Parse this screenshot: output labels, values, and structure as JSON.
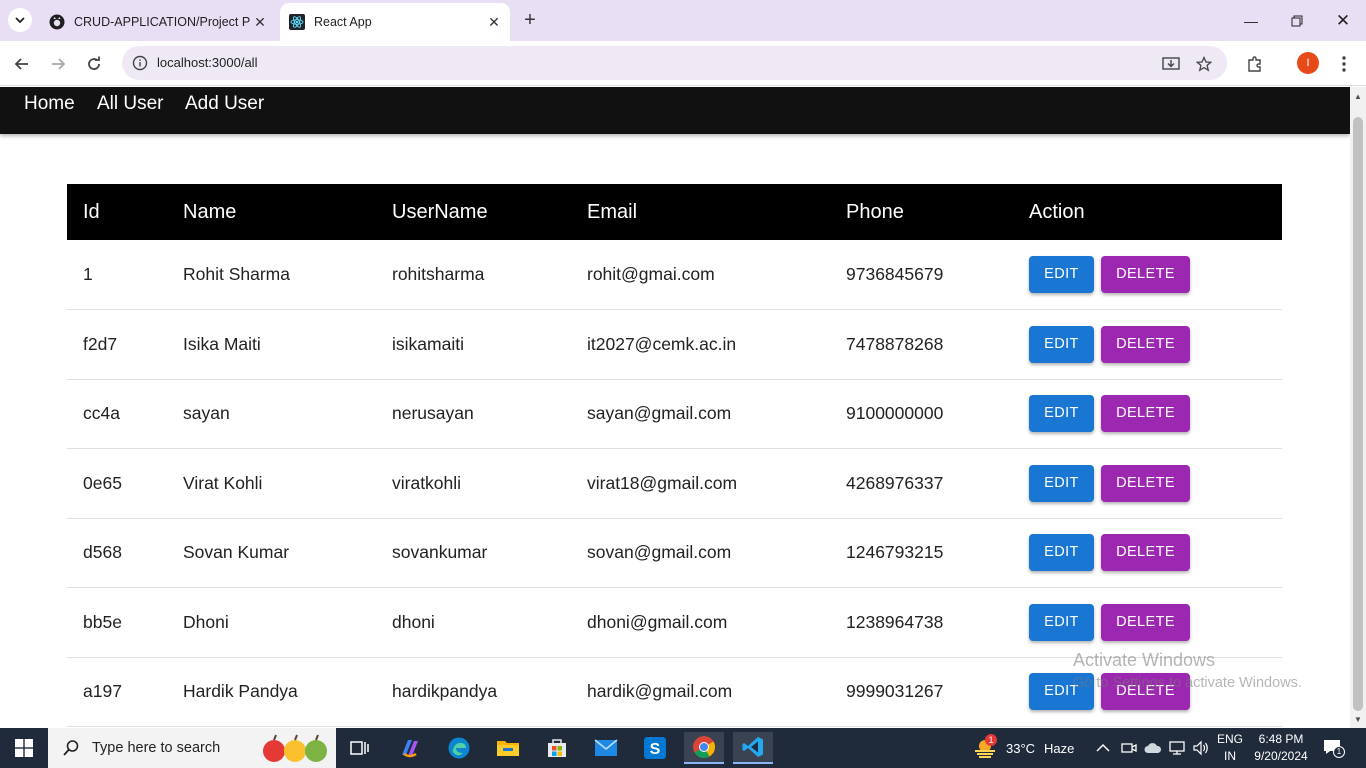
{
  "browser": {
    "tabs": [
      {
        "title": "CRUD-APPLICATION/Project Pr",
        "active": false
      },
      {
        "title": "React App",
        "active": true
      }
    ],
    "url": "localhost:3000/all",
    "profile_initial": "I"
  },
  "nav": {
    "home": "Home",
    "all_users": "All User",
    "add_user": "Add User"
  },
  "table": {
    "headers": [
      "Id",
      "Name",
      "UserName",
      "Email",
      "Phone",
      "Action"
    ],
    "edit_label": "EDIT",
    "delete_label": "DELETE",
    "rows": [
      {
        "id": "1",
        "name": "Rohit Sharma",
        "username": "rohitsharma",
        "email": "rohit@gmai.com",
        "phone": "9736845679"
      },
      {
        "id": "f2d7",
        "name": "Isika Maiti",
        "username": "isikamaiti",
        "email": "it2027@cemk.ac.in",
        "phone": "7478878268"
      },
      {
        "id": "cc4a",
        "name": "sayan",
        "username": "nerusayan",
        "email": "sayan@gmail.com",
        "phone": "9100000000"
      },
      {
        "id": "0e65",
        "name": "Virat Kohli",
        "username": "viratkohli",
        "email": "virat18@gmail.com",
        "phone": "4268976337"
      },
      {
        "id": "d568",
        "name": "Sovan Kumar",
        "username": "sovankumar",
        "email": "sovan@gmail.com",
        "phone": "1246793215"
      },
      {
        "id": "bb5e",
        "name": "Dhoni",
        "username": "dhoni",
        "email": "dhoni@gmail.com",
        "phone": "1238964738"
      },
      {
        "id": "a197",
        "name": "Hardik Pandya",
        "username": "hardikpandya",
        "email": "hardik@gmail.com",
        "phone": "9999031267"
      }
    ]
  },
  "watermark": {
    "title": "Activate Windows",
    "subtitle": "Go to Settings to activate Windows."
  },
  "taskbar": {
    "search_placeholder": "Type here to search",
    "weather_temp": "33°C",
    "weather_desc": "Haze",
    "weather_badge": "1",
    "lang_line1": "ENG",
    "lang_line2": "IN",
    "time": "6:48 PM",
    "date": "9/20/2024",
    "notification_count": "1"
  },
  "colors": {
    "edit_button": "#1976d2",
    "delete_button": "#9c27b0",
    "appbar": "#111111",
    "table_header": "#000000",
    "tabstrip": "#e9dff5"
  }
}
